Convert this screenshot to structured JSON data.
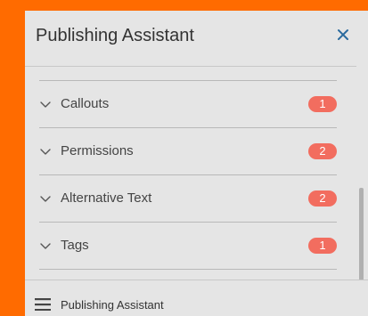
{
  "panel": {
    "title": "Publishing Assistant",
    "close_icon": "close-icon"
  },
  "sections": [
    {
      "label": "Callouts",
      "count": "1",
      "icon": "chevron-down-icon"
    },
    {
      "label": "Permissions",
      "count": "2",
      "icon": "chevron-down-icon"
    },
    {
      "label": "Alternative Text",
      "count": "2",
      "icon": "chevron-down-icon"
    },
    {
      "label": "Tags",
      "count": "1",
      "icon": "chevron-down-icon"
    }
  ],
  "footer": {
    "label": "Publishing Assistant",
    "icon": "menu-icon"
  },
  "colors": {
    "background": "#ff6b00",
    "panel": "#e5e5e5",
    "badge": "#f26d5f",
    "accent": "#2a6a9e"
  }
}
